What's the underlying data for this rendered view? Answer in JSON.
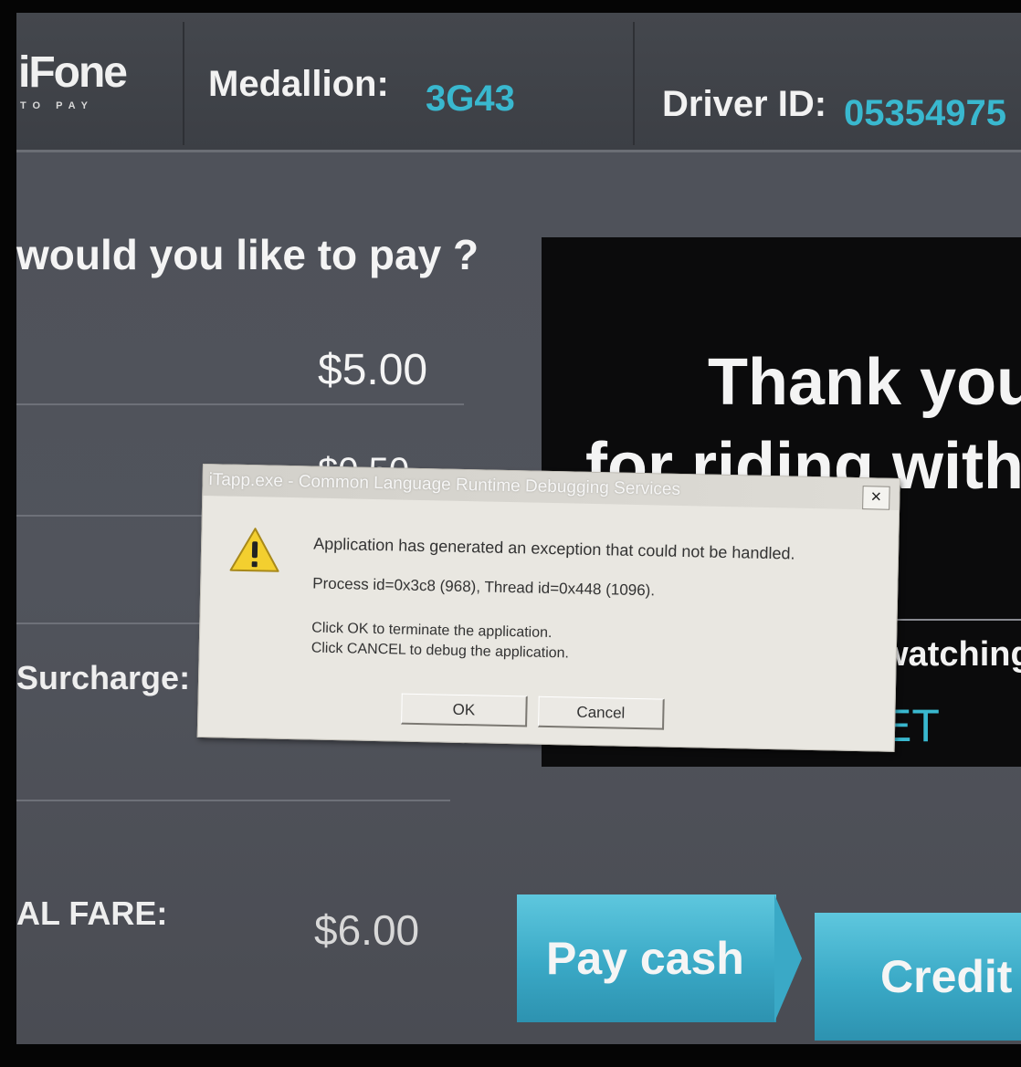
{
  "header": {
    "logo_text": "iFone",
    "logo_sub": "TO PAY",
    "medallion_label": "Medallion:",
    "medallion_value": "3G43",
    "driver_label": "Driver ID:",
    "driver_value": "05354975"
  },
  "fare": {
    "question": "would you like to pay ?",
    "fare_amount": "$5.00",
    "partial_amount": "$0.50",
    "surcharge_label": "Surcharge:",
    "total_label": "AL FARE:",
    "total_amount": "$6.00"
  },
  "panel": {
    "line1": "Thank you",
    "line2": "for riding with",
    "line3": "watching",
    "line4": "ET"
  },
  "buttons": {
    "pay_cash": "Pay cash",
    "credit": "Credit"
  },
  "dialog": {
    "title": "iTapp.exe - Common Language Runtime Debugging Services",
    "close": "×",
    "message": "Application has generated an exception that could not be handled.",
    "process": "Process id=0x3c8 (968), Thread id=0x448 (1096).",
    "ok_hint": "Click OK to terminate the application.",
    "cancel_hint": "Click CANCEL to debug the application.",
    "ok_label": "OK",
    "cancel_label": "Cancel",
    "icon": "warning-icon"
  },
  "colors": {
    "accent": "#39b8cf",
    "button": "#3aa9c6",
    "panel": "#0b0b0c"
  }
}
